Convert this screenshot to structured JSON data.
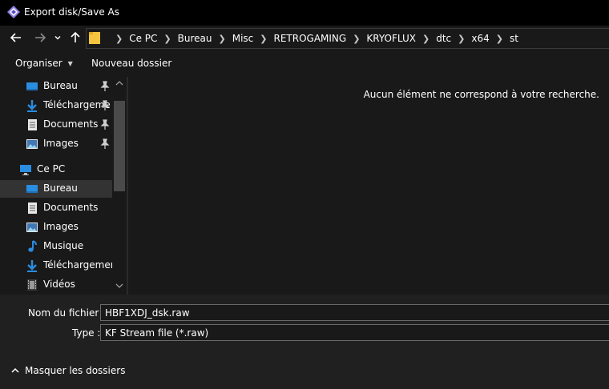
{
  "window": {
    "title": "Export disk/Save As"
  },
  "navigation": {
    "breadcrumbs": [
      "Ce PC",
      "Bureau",
      "Misc",
      "RETROGAMING",
      "KRYOFLUX",
      "dtc",
      "x64",
      "st"
    ]
  },
  "commandbar": {
    "organize": "Organiser",
    "new_folder": "Nouveau dossier"
  },
  "sidebar": {
    "quick_access": [
      {
        "label": "Bureau",
        "icon": "desktop-icon",
        "pinned": true
      },
      {
        "label": "Téléchargements",
        "icon": "download-icon",
        "pinned": true
      },
      {
        "label": "Documents",
        "icon": "documents-icon",
        "pinned": true
      },
      {
        "label": "Images",
        "icon": "images-icon",
        "pinned": true
      }
    ],
    "this_pc": {
      "label": "Ce PC",
      "icon": "computer-icon"
    },
    "pc_items": [
      {
        "label": "Bureau",
        "icon": "desktop-icon",
        "selected": true
      },
      {
        "label": "Documents",
        "icon": "documents-icon"
      },
      {
        "label": "Images",
        "icon": "images-icon"
      },
      {
        "label": "Musique",
        "icon": "music-icon"
      },
      {
        "label": "Téléchargements",
        "icon": "download-icon"
      },
      {
        "label": "Vidéos",
        "icon": "videos-icon"
      }
    ]
  },
  "content": {
    "empty_message": "Aucun élément ne correspond à votre recherche."
  },
  "save": {
    "filename_label": "Nom du fichier :",
    "filename_value": "HBF1XDJ_dsk.raw",
    "type_label": "Type :",
    "type_value": "KF Stream file (*.raw)"
  },
  "footer": {
    "hide_folders": "Masquer les dossiers"
  },
  "colors": {
    "window_bg": "#191919",
    "titlebar_bg": "#000000",
    "bottom_bg": "#202020",
    "selected_bg": "#333333",
    "accent_blue": "#2a8de0",
    "folder_yellow": "#f5c542"
  }
}
